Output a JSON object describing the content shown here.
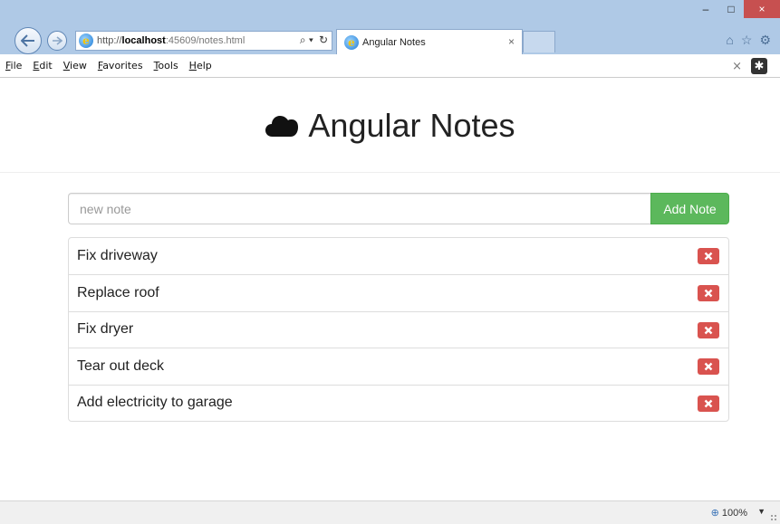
{
  "browser": {
    "url_prefix": "http://",
    "url_host": "localhost",
    "url_rest": ":45609/notes.html",
    "search_glyph": "⌕ ▾",
    "refresh_glyph": "↻",
    "tab_title": "Angular Notes",
    "tab_close": "×",
    "window_controls": {
      "minimize": "–",
      "maximize": "□",
      "close": "×"
    },
    "toolbar_icons": {
      "home": "⌂",
      "favorites": "☆",
      "settings": "⚙"
    },
    "ie_logo": "e",
    "icons": [
      "back-arrow-icon",
      "forward-arrow-icon",
      "ie-logo-icon",
      "search-icon",
      "refresh-icon",
      "home-icon",
      "star-icon",
      "gear-icon"
    ]
  },
  "menubar": {
    "items": [
      "File",
      "Edit",
      "View",
      "Favorites",
      "Tools",
      "Help"
    ],
    "close_glyph": "×",
    "addon_glyph": "✱"
  },
  "app": {
    "title": "Angular Notes",
    "input_placeholder": "new note",
    "add_button_label": "Add Note",
    "notes": [
      "Fix driveway",
      "Replace roof",
      "Fix dryer",
      "Tear out deck",
      "Add electricity to garage"
    ],
    "colors": {
      "add_button": "#5cb85c",
      "delete_button": "#d9534f",
      "title_text": "#222222"
    }
  },
  "statusbar": {
    "zoom_level": "100%",
    "zoom_arrow": "▼"
  }
}
